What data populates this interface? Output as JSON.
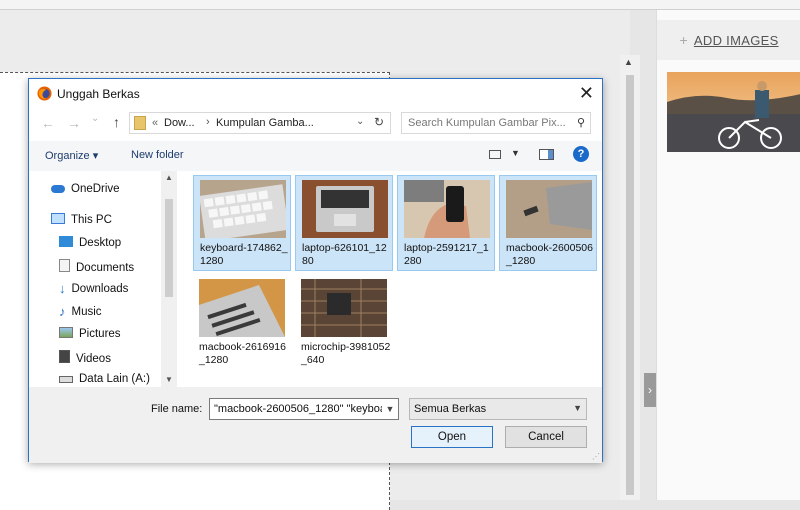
{
  "right_panel": {
    "add_images_plus": "+",
    "add_images_label": "ADD IMAGES"
  },
  "dialog": {
    "title": "Unggah Berkas",
    "close": "✕",
    "nav": {
      "back": "←",
      "forward": "→",
      "recent": "⌄",
      "up": "↑"
    },
    "address": {
      "overflow": "«",
      "segment1": "Dow...",
      "separator": "›",
      "segment2": "Kumpulan Gamba...",
      "dropdown": "⌄",
      "refresh": "↻"
    },
    "search_placeholder": "Search Kumpulan Gambar Pix...",
    "toolbar": {
      "organize": "Organize ▾",
      "new_folder": "New folder",
      "help": "?"
    },
    "nav_items": [
      {
        "label": "OneDrive",
        "icon": "cloud-icon"
      },
      {
        "label": "This PC",
        "icon": "computer-icon"
      },
      {
        "label": "Desktop",
        "icon": "desktop-icon"
      },
      {
        "label": "Documents",
        "icon": "documents-icon"
      },
      {
        "label": "Downloads",
        "icon": "download-arrow-icon"
      },
      {
        "label": "Music",
        "icon": "music-note-icon"
      },
      {
        "label": "Pictures",
        "icon": "pictures-icon"
      },
      {
        "label": "Videos",
        "icon": "videos-icon"
      },
      {
        "label": "Data Lain (A:)",
        "icon": "drive-icon"
      }
    ],
    "files": [
      {
        "name": "keyboard-174862_1280",
        "selected": true
      },
      {
        "name": "laptop-626101_1280",
        "selected": true
      },
      {
        "name": "laptop-2591217_1280",
        "selected": true
      },
      {
        "name": "macbook-2600506_1280",
        "selected": true
      },
      {
        "name": "macbook-2616916_1280",
        "selected": false
      },
      {
        "name": "microchip-3981052_640",
        "selected": false
      }
    ],
    "file_name_label": "File name:",
    "file_name_value": "\"macbook-2600506_1280\" \"keyboa",
    "file_type": "Semua Berkas",
    "open_label": "Open",
    "cancel_label": "Cancel"
  },
  "colors": {
    "accent": "#2a72c4",
    "selection": "#cce4f7",
    "help": "#1b6ac9"
  }
}
